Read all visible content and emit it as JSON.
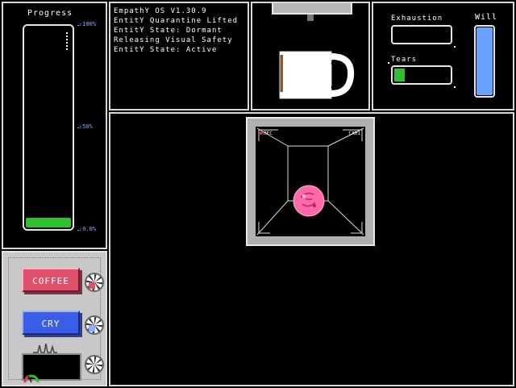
{
  "progress": {
    "title": "Progress",
    "value_percent": 5,
    "ticks": [
      {
        "label": "-100%",
        "level": 100
      },
      {
        "label": "-50%",
        "level": 50
      },
      {
        "label": "-0.0%",
        "level": 0
      }
    ],
    "fill_color": "#2fbf2f",
    "tick_color": "#8aa7ff"
  },
  "controls": {
    "coffee_label": "COFFEE",
    "cry_label": "CRY",
    "coffee_color": "#e0506a",
    "cry_color": "#3b5ee8"
  },
  "log": {
    "lines": [
      "EmpathY OS V1.30.9",
      "EntitY Quarantine Lifted",
      "EntitY State: Dormant",
      "Releasing Visual Safety",
      "EntitY State: Active"
    ]
  },
  "stats": {
    "exhaustion_label": "Exhaustion",
    "exhaustion_level": 0,
    "tears_label": "Tears",
    "tears_level": 0.18,
    "will_label": "Will",
    "will_level": 1.0,
    "will_color": "#6aa0ff"
  },
  "camera": {
    "rec_label": "REC",
    "cam_label": "CAM1",
    "entity_color": "#ff6aa8"
  }
}
